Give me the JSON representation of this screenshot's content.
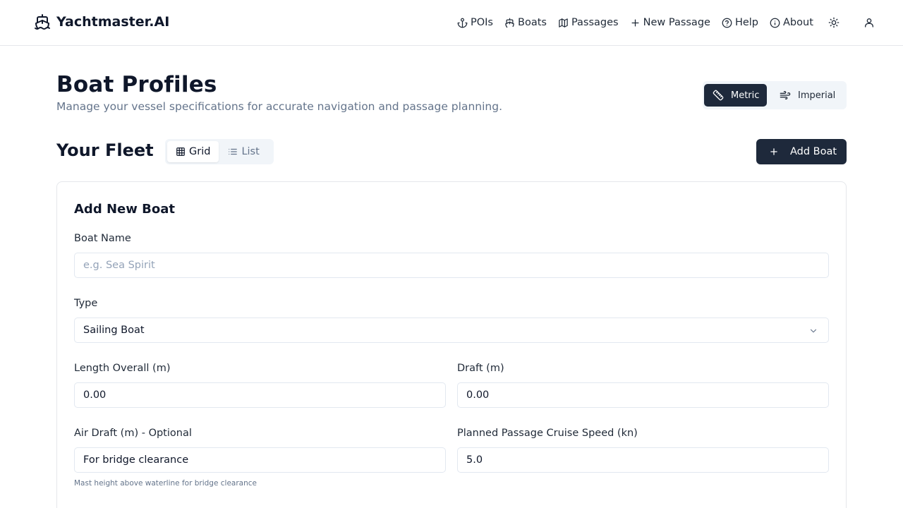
{
  "app": {
    "brand": "Yachtmaster.AI",
    "brand_icon": "ship-icon"
  },
  "nav": {
    "pois": "POIs",
    "boats": "Boats",
    "passages": "Passages",
    "new_passage": "New Passage",
    "help": "Help",
    "about": "About"
  },
  "header_actions": {
    "theme_icon": "sun-icon",
    "user_icon": "user-icon"
  },
  "page": {
    "title": "Boat Profiles",
    "subtitle": "Manage your vessel specifications for accurate navigation and passage planning."
  },
  "units": {
    "metric": "Metric",
    "imperial": "Imperial",
    "selected": "Metric"
  },
  "fleet": {
    "title": "Your Fleet",
    "grid_label": "Grid",
    "list_label": "List",
    "selected_view": "Grid",
    "add_button": "Add Boat"
  },
  "form": {
    "title": "Add New Boat",
    "boat_name": {
      "label": "Boat Name",
      "placeholder": "e.g. Sea Spirit",
      "value": ""
    },
    "type": {
      "label": "Type",
      "value": "Sailing Boat"
    },
    "length_overall": {
      "label": "Length Overall (m)",
      "value": "0.00"
    },
    "draft": {
      "label": "Draft (m)",
      "value": "0.00"
    },
    "air_draft": {
      "label": "Air Draft (m) - Optional",
      "value": "For bridge clearance",
      "help": "Mast height above waterline for bridge clearance"
    },
    "cruise_speed": {
      "label": "Planned Passage Cruise Speed (kn)",
      "value": "5.0"
    }
  },
  "colors": {
    "primary_dark": "#1e293b",
    "muted_text": "#64748b",
    "border": "#e5e7eb",
    "toggle_bg": "#f1f5f9"
  }
}
